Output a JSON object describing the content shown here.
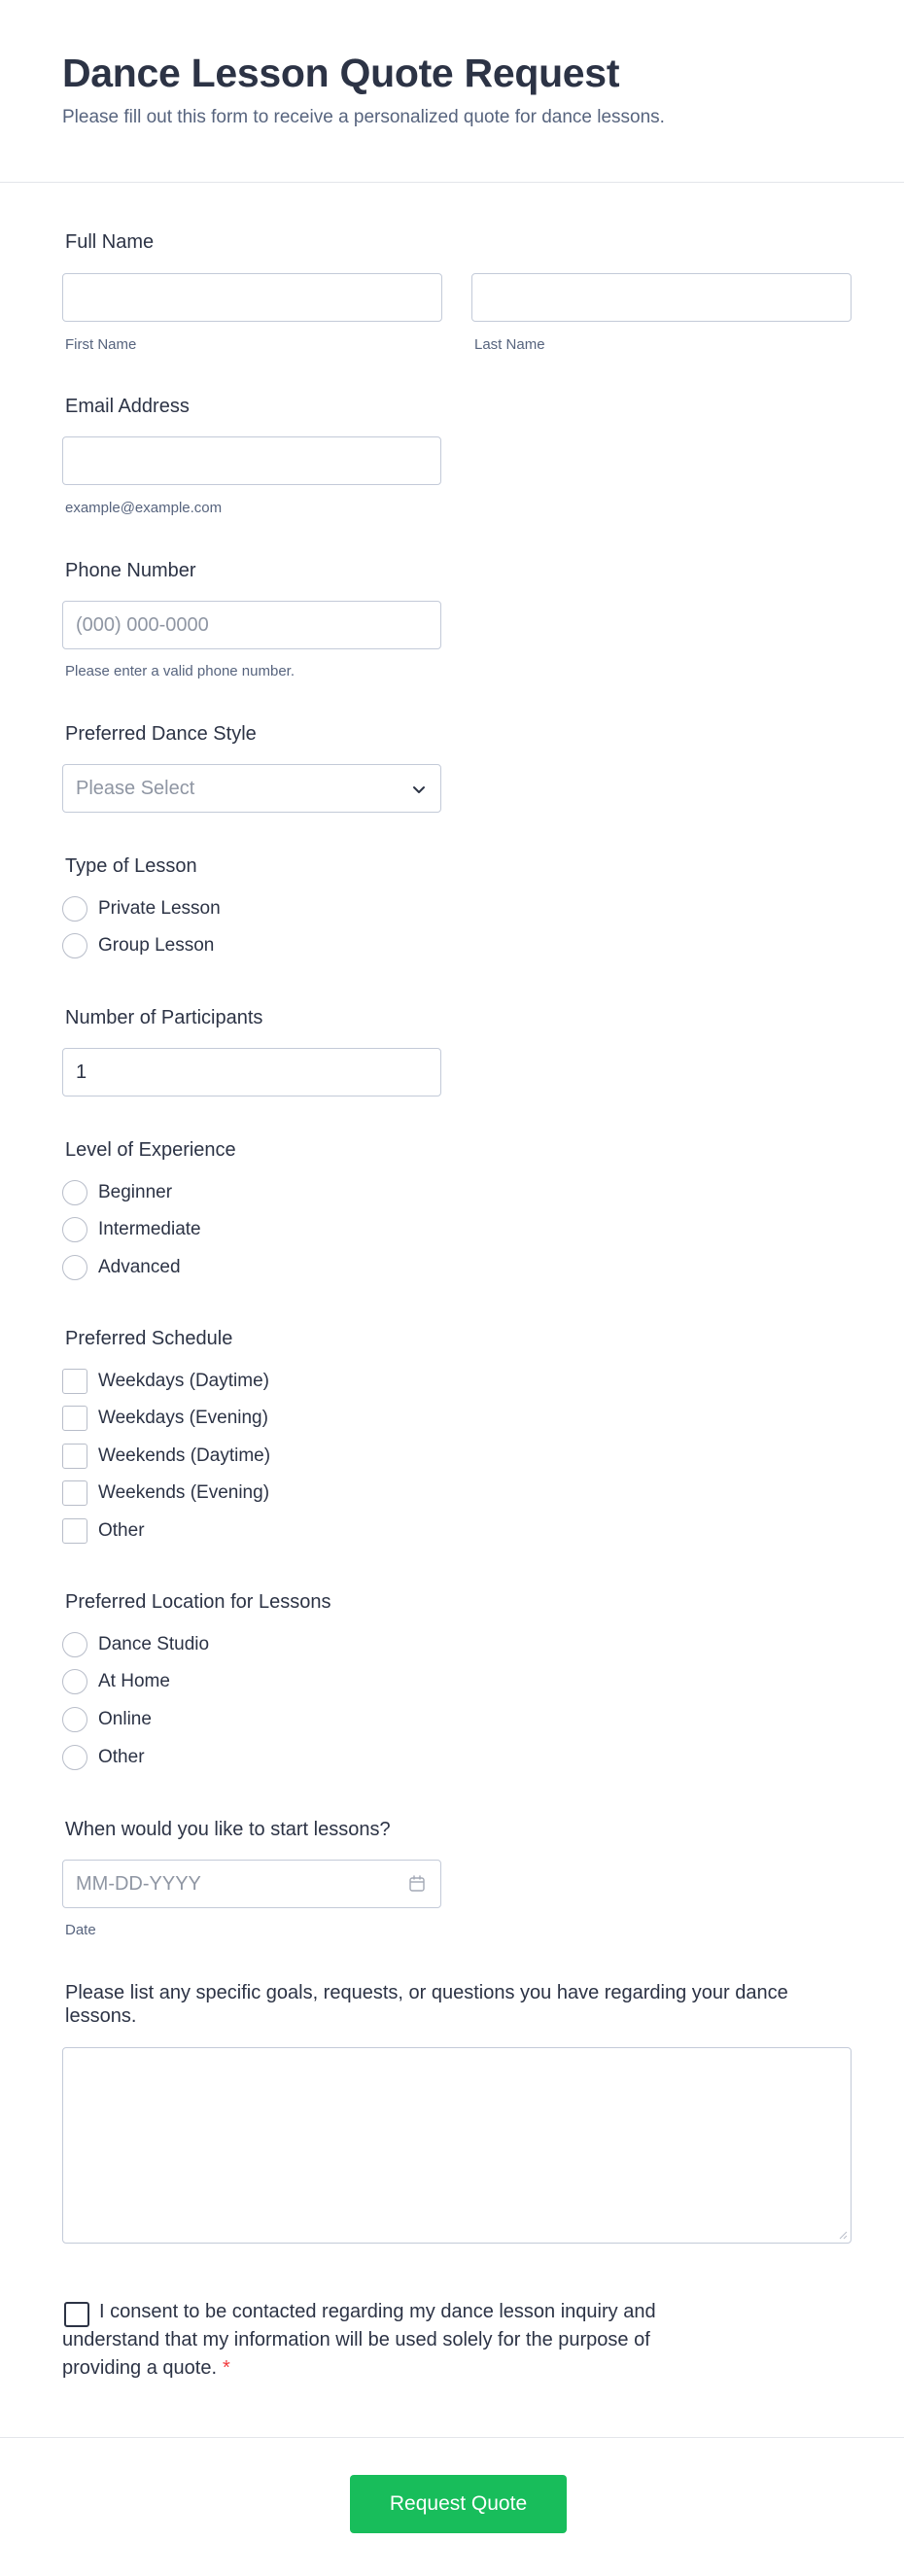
{
  "header": {
    "title": "Dance Lesson Quote Request",
    "subtitle": "Please fill out this form to receive a personalized quote for dance lessons."
  },
  "full_name": {
    "label": "Full Name",
    "first_sublabel": "First Name",
    "last_sublabel": "Last Name",
    "first_value": "",
    "last_value": ""
  },
  "email": {
    "label": "Email Address",
    "sublabel": "example@example.com",
    "value": ""
  },
  "phone": {
    "label": "Phone Number",
    "placeholder": "(000) 000-0000",
    "sublabel": "Please enter a valid phone number."
  },
  "dance_style": {
    "label": "Preferred Dance Style",
    "selected": "Please Select",
    "icon": "chevron-down-icon"
  },
  "lesson_type": {
    "label": "Type of Lesson",
    "options": [
      "Private Lesson",
      "Group Lesson"
    ]
  },
  "participants": {
    "label": "Number of Participants",
    "value": "1"
  },
  "experience": {
    "label": "Level of Experience",
    "options": [
      "Beginner",
      "Intermediate",
      "Advanced"
    ]
  },
  "schedule": {
    "label": "Preferred Schedule",
    "options": [
      "Weekdays (Daytime)",
      "Weekdays (Evening)",
      "Weekends (Daytime)",
      "Weekends (Evening)",
      "Other"
    ]
  },
  "location": {
    "label": "Preferred Location for Lessons",
    "options": [
      "Dance Studio",
      "At Home",
      "Online",
      "Other"
    ]
  },
  "start_date": {
    "label": "When would you like to start lessons?",
    "placeholder": "MM-DD-YYYY",
    "sublabel": "Date",
    "icon": "calendar-icon"
  },
  "goals": {
    "label": "Please list any specific goals, requests, or questions you have regarding your dance lessons.",
    "value": ""
  },
  "consent": {
    "text": "I consent to be contacted regarding my dance lesson inquiry and understand that my information will be used solely for the purpose of providing a quote.",
    "required_mark": "*"
  },
  "submit": {
    "label": "Request Quote"
  },
  "colors": {
    "accent": "#18bd5b",
    "text": "#2c3345",
    "muted": "#57647e",
    "border": "#c3cad8",
    "required": "#f23a3c"
  }
}
